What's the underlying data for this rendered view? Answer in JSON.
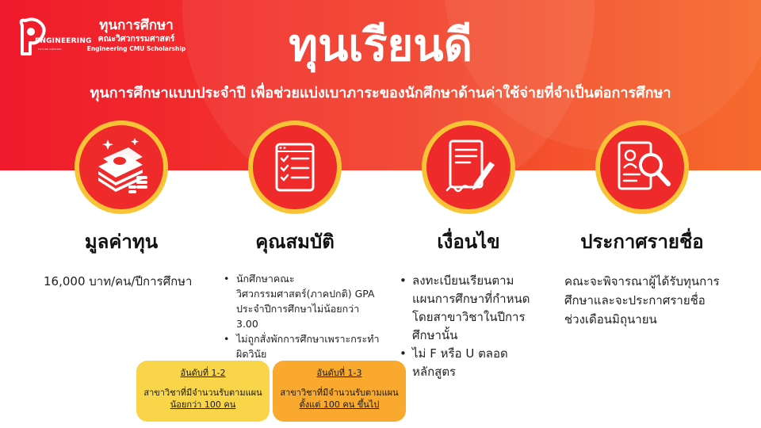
{
  "logo": {
    "mark_word": "ENGINEERING",
    "mark_sub": "FUTURE GREATER",
    "title": "ทุนการศึกษา",
    "subtitle": "คณะวิศวกรรมศาสตร์",
    "tagline": "Engineering CMU Scholarship"
  },
  "header": {
    "title": "ทุนเรียนดี",
    "subtitle": "ทุนการศึกษาแบบประจำปี เพื่อช่วยแบ่งเบาภาระของนักศึกษาด้านค่าใช้จ่ายที่จำเป็นต่อการศึกษา"
  },
  "colors": {
    "hero_start": "#f01a2c",
    "hero_end": "#f66b2e",
    "icon_circle": "#ee2a2a",
    "icon_ring": "#f8c436",
    "rank_yellow": "#f9d649",
    "rank_orange": "#f8a92e"
  },
  "columns": [
    {
      "icon": "money-stack-icon",
      "title": "มูลค่าทุน",
      "text": "16,000 บาท/คน/ปีการศึกษา"
    },
    {
      "icon": "checklist-icon",
      "title": "คุณสมบัติ",
      "items": [
        "นักศึกษาคณะวิศวกรรมศาสตร์(ภาคปกติ) GPA ประจำปีการศึกษาไม่น้อยกว่า 3.00",
        "ไม่ถูกสั่งพักการศึกษาเพราะกระทำผิดวินัย"
      ]
    },
    {
      "icon": "document-sign-icon",
      "title": "เงื่อนไข",
      "items": [
        "ลงทะเบียนเรียนตามแผนการศึกษาที่กำหนดโดยสาขาวิชาในปีการศึกษานั้น",
        "ไม่ F หรือ U ตลอดหลักสูตร"
      ]
    },
    {
      "icon": "profile-search-icon",
      "title": "ประกาศรายชื่อ",
      "text": "คณะจะพิจารณาผู้ได้รับทุนการศึกษาและจะประกาศรายชื่อช่วงเดือนมิถุนายน"
    }
  ],
  "ranks": [
    {
      "rank": "อันดับที่ 1-2",
      "line1": "สาขาวิชาที่มีจำนวนรับตามแผน",
      "line2": "น้อยกว่า 100 คน"
    },
    {
      "rank": "อันดับที่ 1-3",
      "line1": "สาขาวิชาที่มีจำนวนรับตามแผน",
      "line2": "ตั้งแต่ 100 คน ขึ้นไป"
    }
  ]
}
